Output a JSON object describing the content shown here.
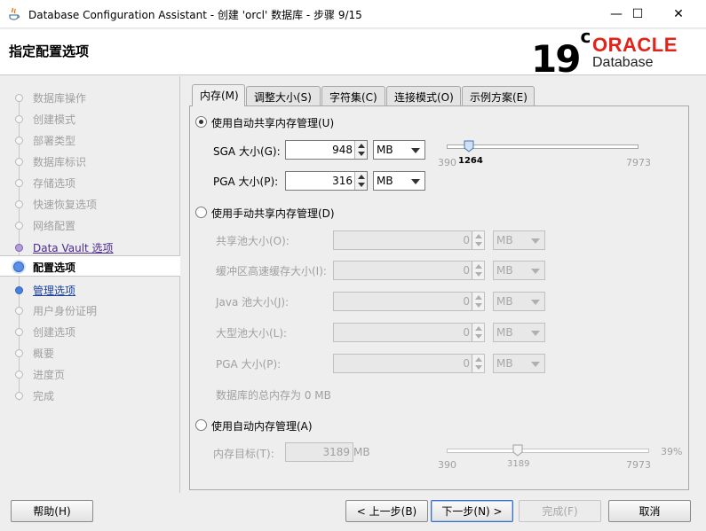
{
  "window": {
    "title": "Database Configuration Assistant - 创建 'orcl' 数据库 - 步骤 9/15",
    "controls": {
      "minimize": "—",
      "maximize": "☐",
      "close": "✕"
    }
  },
  "header": {
    "title": "指定配置选项",
    "version": "19",
    "version_suffix": "c",
    "brand": "ORACLE",
    "product": "Database",
    "brand_color": "#e2231a"
  },
  "nav": {
    "steps": [
      {
        "label": "数据库操作",
        "state": "done"
      },
      {
        "label": "创建模式",
        "state": "done"
      },
      {
        "label": "部署类型",
        "state": "done"
      },
      {
        "label": "数据库标识",
        "state": "done"
      },
      {
        "label": "存储选项",
        "state": "done"
      },
      {
        "label": "快速恢复选项",
        "state": "done"
      },
      {
        "label": "网络配置",
        "state": "done"
      },
      {
        "label": "Data Vault 选项",
        "state": "visited"
      },
      {
        "label": "配置选项",
        "state": "current"
      },
      {
        "label": "管理选项",
        "state": "next"
      },
      {
        "label": "用户身份证明",
        "state": "pending"
      },
      {
        "label": "创建选项",
        "state": "pending"
      },
      {
        "label": "概要",
        "state": "pending"
      },
      {
        "label": "进度页",
        "state": "pending"
      },
      {
        "label": "完成",
        "state": "pending"
      }
    ]
  },
  "tabs": [
    "内存(M)",
    "调整大小(S)",
    "字符集(C)",
    "连接模式(O)",
    "示例方案(E)"
  ],
  "memory": {
    "asmm": {
      "label": "使用自动共享内存管理(U)",
      "selected": true,
      "sga": {
        "label": "SGA 大小(G):",
        "value": "948",
        "unit": "MB"
      },
      "pga": {
        "label": "PGA 大小(P):",
        "value": "316",
        "unit": "MB"
      },
      "slider": {
        "min": "390",
        "value": "1264",
        "max": "7973"
      }
    },
    "manual": {
      "label": "使用手动共享内存管理(D)",
      "selected": false,
      "fields": [
        {
          "label": "共享池大小(O):",
          "value": "0",
          "unit": "MB"
        },
        {
          "label": "缓冲区高速缓存大小(I):",
          "value": "0",
          "unit": "MB"
        },
        {
          "label": "Java 池大小(J):",
          "value": "0",
          "unit": "MB"
        },
        {
          "label": "大型池大小(L):",
          "value": "0",
          "unit": "MB"
        },
        {
          "label": "PGA 大小(P):",
          "value": "0",
          "unit": "MB"
        }
      ],
      "total": "数据库的总内存为 0 MB"
    },
    "amm": {
      "label": "使用自动内存管理(A)",
      "selected": false,
      "target_label": "内存目标(T):",
      "target_value": "3189",
      "target_unit": "MB",
      "slider": {
        "min": "390",
        "value": "3189",
        "max": "7973",
        "percent": "39%"
      }
    }
  },
  "buttons": {
    "help": "帮助(H)",
    "back": "< 上一步(B)",
    "next": "下一步(N) >",
    "finish": "完成(F)",
    "cancel": "取消"
  }
}
